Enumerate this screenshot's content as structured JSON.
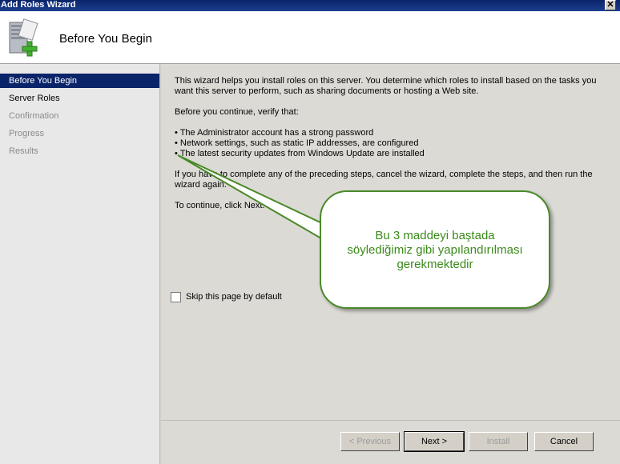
{
  "window": {
    "title": "Add Roles Wizard",
    "close_glyph": "✕"
  },
  "header": {
    "title": "Before You Begin",
    "icon": "server-add-icon"
  },
  "sidebar": {
    "items": [
      {
        "label": "Before You Begin",
        "state": "active"
      },
      {
        "label": "Server Roles",
        "state": "enabled"
      },
      {
        "label": "Confirmation",
        "state": "disabled"
      },
      {
        "label": "Progress",
        "state": "disabled"
      },
      {
        "label": "Results",
        "state": "disabled"
      }
    ]
  },
  "content": {
    "intro": "This wizard helps you install roles on this server. You determine which roles to install based on the tasks you want this server to perform, such as sharing documents or hosting a Web site.",
    "verify": "Before you continue, verify that:",
    "bullets": [
      "• The Administrator account has a strong password",
      "• Network settings, such as static IP addresses, are configured",
      "• The latest security updates from Windows Update are installed"
    ],
    "if_steps": "If you have to complete any of the preceding steps, cancel the wizard, complete the steps, and then run the wizard again.",
    "continue": "To continue, click Next.",
    "skip_label": "Skip this page by default"
  },
  "callout": {
    "text_line1": "Bu 3 maddeyi baştada",
    "text_line2": "söylediğimiz gibi yapılandırılması",
    "text_line3": "gerekmektedir",
    "color": "#3a8a1a"
  },
  "buttons": {
    "previous": "< Previous",
    "next": "Next >",
    "install": "Install",
    "cancel": "Cancel"
  }
}
